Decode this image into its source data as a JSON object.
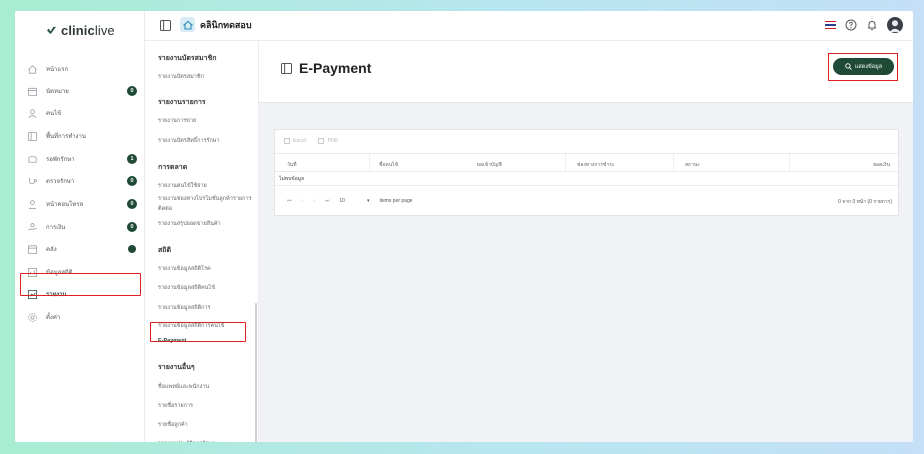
{
  "brand": {
    "name_bold": "clinic",
    "name_rest": "live"
  },
  "header": {
    "clinic_name": "คลินิกทดสอบ"
  },
  "sidebar": {
    "items": [
      {
        "label": "หน้าแรก",
        "icon": "home-icon"
      },
      {
        "label": "นัดหมาย",
        "icon": "calendar-icon",
        "badge": "0"
      },
      {
        "label": "คนไข้",
        "icon": "user-icon"
      },
      {
        "label": "พื้นที่การทำงาน",
        "icon": "workspace-icon"
      },
      {
        "label": "รอพักรักษา",
        "icon": "sofa-icon",
        "badge": "1"
      },
      {
        "label": "ตรวจรักษา",
        "icon": "stethoscope-icon",
        "badge": "0"
      },
      {
        "label": "หน้าคอนโทรล",
        "icon": "person-icon",
        "badge": "0"
      },
      {
        "label": "การเงิน",
        "icon": "payment-icon",
        "badge": "0"
      },
      {
        "label": "คลัง",
        "icon": "stock-icon",
        "badge": ""
      },
      {
        "label": "ข้อมูลสถิติ",
        "icon": "stats-icon"
      },
      {
        "label": "รายงาน",
        "icon": "report-icon",
        "active": true
      },
      {
        "label": "ตั้งค่า",
        "icon": "gear-icon"
      }
    ]
  },
  "submenu": {
    "items": [
      {
        "type": "head",
        "label": "รายงานบัตรสมาชิก"
      },
      {
        "type": "item",
        "label": "รายงานบัตรสมาชิก"
      },
      {
        "type": "head",
        "label": "รายงานรายการ"
      },
      {
        "type": "item",
        "label": "รายงานการขาย"
      },
      {
        "type": "item",
        "label": "รายงานบัตรสิทธิ์การรักษา"
      },
      {
        "type": "head",
        "label": "การตลาด"
      },
      {
        "type": "item",
        "label": "รายงานคนไข้ใช้จ่าย"
      },
      {
        "type": "item",
        "label": "รายงานช่องทางโปรโมชั่นลูกค้ารายการ"
      },
      {
        "type": "item",
        "label": "ติดต่อ"
      },
      {
        "type": "item",
        "label": "รายงานสรุปยอดขายสินค้า"
      },
      {
        "type": "head",
        "label": "สถิติ"
      },
      {
        "type": "item",
        "label": "รายงานข้อมูลสถิติโรค"
      },
      {
        "type": "item",
        "label": "รายงานข้อมูลสถิติคนไข้"
      },
      {
        "type": "item",
        "label": "รายงานข้อมูลสถิติการ"
      },
      {
        "type": "item",
        "label": "รายงานข้อมูลสถิติการคนไข้"
      },
      {
        "type": "item",
        "label": "E-Payment",
        "active": true
      },
      {
        "type": "head",
        "label": "รายงานอื่นๆ"
      },
      {
        "type": "item",
        "label": "ชื่อแพทย์และพนักงาน"
      },
      {
        "type": "item",
        "label": "รายชื่อรายการ"
      },
      {
        "type": "item",
        "label": "รายชื่อลูกค้า"
      },
      {
        "type": "item",
        "label": "รายงานประวัติการรักษา"
      }
    ]
  },
  "main": {
    "title": "E-Payment",
    "show_button": "แสดงข้อมูล",
    "export": {
      "excel": "Excel",
      "pdf": "PDF"
    },
    "columns": [
      "วันที่",
      "ชื่อคนไข้",
      "ผลเข้าบัญชี",
      "ช่องทางการชำระ",
      "สถานะ",
      "ยอดเงิน"
    ],
    "empty_text": "ไม่พบข้อมูล",
    "pager": {
      "page_size": "10",
      "items_per_page": "items per page",
      "summary": "0 จาก 0 หน้า (0 รายการ)"
    }
  },
  "colors": {
    "brand_green": "#1f4a36",
    "highlight_red": "#e02020"
  }
}
